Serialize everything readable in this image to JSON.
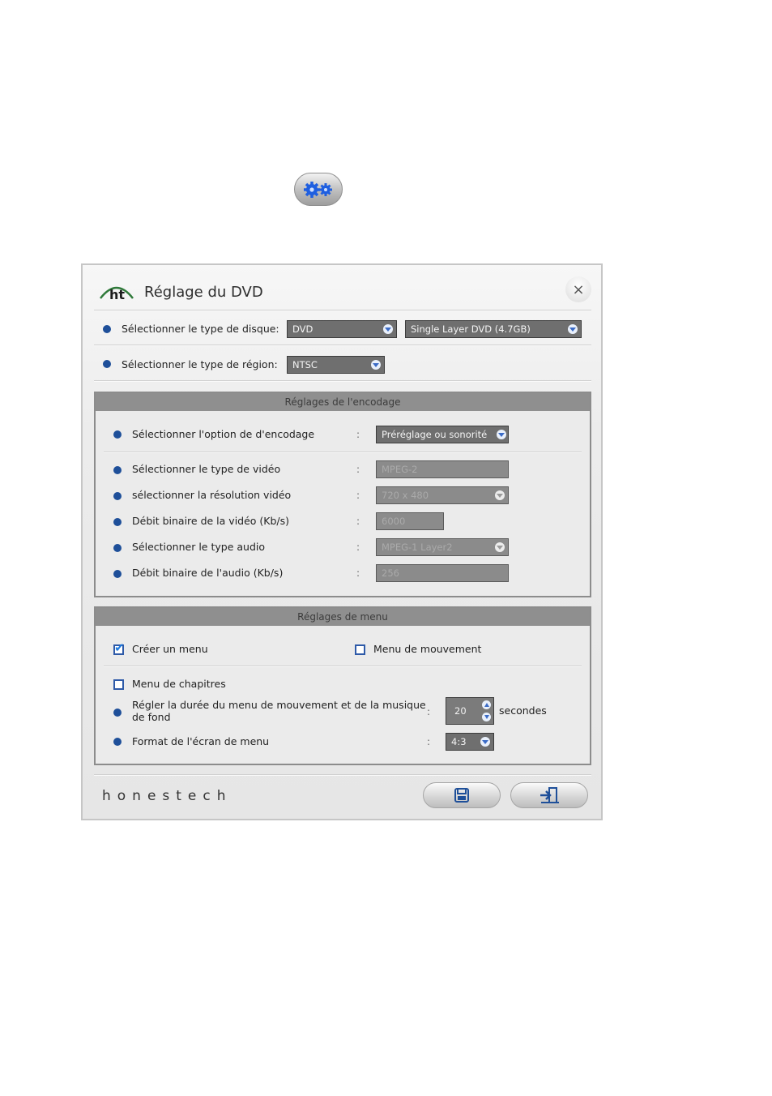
{
  "dialog": {
    "title": "Réglage du DVD",
    "logo_text": "ht",
    "close_label": "×",
    "brand": "honestech"
  },
  "disc": {
    "label": "Sélectionner le type de disque:",
    "type_value": "DVD",
    "capacity_value": "Single Layer DVD (4.7GB)"
  },
  "region": {
    "label": "Sélectionner le type de région:",
    "value": "NTSC"
  },
  "encoding": {
    "header": "Réglages de l'encodage",
    "colon": ":",
    "option_label": "Sélectionner l'option de d'encodage",
    "option_value": "Préréglage ou sonorité",
    "video_type_label": "Sélectionner le type de vidéo",
    "video_type_value": "MPEG-2",
    "resolution_label": "sélectionner la résolution vidéo",
    "resolution_value": "720 x 480",
    "video_bitrate_label": "Débit binaire de la vidéo (Kb/s)",
    "video_bitrate_value": "6000",
    "audio_type_label": "Sélectionner le type audio",
    "audio_type_value": "MPEG-1 Layer2",
    "audio_bitrate_label": "Débit binaire de l'audio (Kb/s)",
    "audio_bitrate_value": "256"
  },
  "menu": {
    "header": "Réglages de menu",
    "colon": ":",
    "create_menu_label": "Créer un menu",
    "create_menu_checked": true,
    "motion_menu_label": "Menu de mouvement",
    "motion_menu_checked": false,
    "chapter_menu_label": "Menu de chapitres",
    "chapter_menu_checked": false,
    "duration_label_1": "Régler la durée du menu de mouvement et de la musique",
    "duration_label_2": "de fond",
    "duration_value": "20",
    "duration_unit": "secondes",
    "screen_format_label": "Format de l'écran de menu",
    "screen_format_value": "4:3"
  },
  "icons": {
    "toolbar": "gear-icon",
    "save": "save-icon",
    "exit": "exit-icon"
  },
  "colors": {
    "accent": "#1e4f99",
    "checkbox": "#1f7be0",
    "field_bg": "#6f6f6f"
  }
}
